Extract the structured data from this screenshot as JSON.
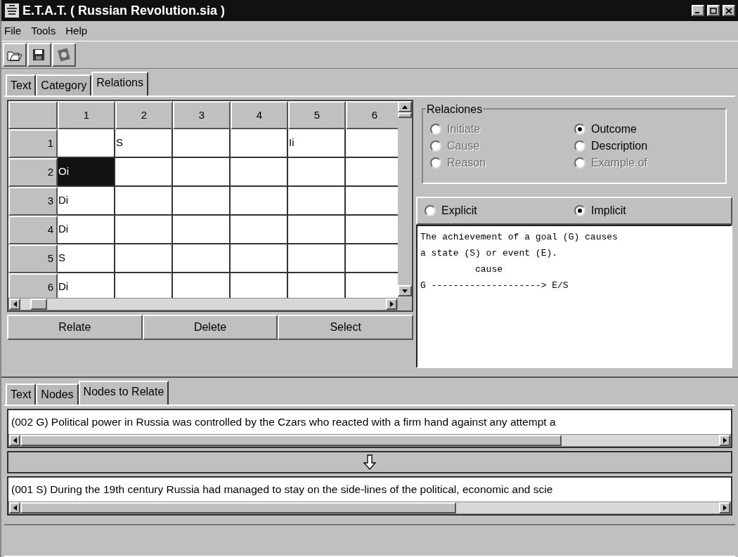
{
  "window": {
    "title": "E.T.A.T. ( Russian Revolution.sia )"
  },
  "menu": [
    "File",
    "Tools",
    "Help"
  ],
  "tabs": [
    {
      "label": "Text",
      "selected": false
    },
    {
      "label": "Category",
      "selected": false
    },
    {
      "label": "Relations",
      "selected": true
    }
  ],
  "grid": {
    "columns": [
      "1",
      "2",
      "3",
      "4",
      "5",
      "6"
    ],
    "rows": [
      {
        "label": "1",
        "cells": [
          {
            "selected": false
          },
          {
            "text": "S",
            "selected": false
          },
          {
            "selected": false
          },
          {
            "selected": false
          },
          {
            "text": "Ii",
            "selected": false
          },
          {
            "selected": false
          }
        ]
      },
      {
        "label": "2",
        "cells": [
          {
            "text": "Oi",
            "selected": true
          },
          {
            "selected": false
          },
          {
            "selected": false
          },
          {
            "selected": false
          },
          {
            "selected": false
          },
          {
            "selected": false
          }
        ]
      },
      {
        "label": "3",
        "cells": [
          {
            "text": "Di",
            "selected": false
          },
          {
            "selected": false
          },
          {
            "selected": false
          },
          {
            "selected": false
          },
          {
            "selected": false
          },
          {
            "selected": false
          }
        ]
      },
      {
        "label": "4",
        "cells": [
          {
            "text": "Di",
            "selected": false
          },
          {
            "selected": false
          },
          {
            "selected": false
          },
          {
            "selected": false
          },
          {
            "selected": false
          },
          {
            "selected": false
          }
        ]
      },
      {
        "label": "5",
        "cells": [
          {
            "text": "S",
            "selected": false
          },
          {
            "selected": false
          },
          {
            "selected": false
          },
          {
            "selected": false
          },
          {
            "selected": false
          },
          {
            "selected": false
          }
        ]
      },
      {
        "label": "6",
        "cells": [
          {
            "text": "Di",
            "selected": false
          },
          {
            "selected": false
          },
          {
            "selected": false
          },
          {
            "selected": false
          },
          {
            "selected": false
          },
          {
            "selected": false
          }
        ]
      }
    ]
  },
  "buttons": [
    "Relate",
    "Delete",
    "Select"
  ],
  "relaciones": {
    "title": "Relaciones",
    "options": [
      {
        "label": "Initiate",
        "selected": false,
        "disabled": true
      },
      {
        "label": "Outcome",
        "selected": true,
        "disabled": false
      },
      {
        "label": "Cause",
        "selected": false,
        "disabled": true
      },
      {
        "label": "Description",
        "selected": false,
        "disabled": false
      },
      {
        "label": "Reason",
        "selected": false,
        "disabled": true
      },
      {
        "label": "Example of",
        "selected": false,
        "disabled": true
      }
    ]
  },
  "mode": [
    {
      "label": "Explicit",
      "selected": false
    },
    {
      "label": "Implicit",
      "selected": true
    }
  ],
  "description": "The achievement of a goal (G) causes\na state (S) or event (E).\n          cause\nG --------------------> E/S",
  "bottom_tabs": [
    {
      "label": "Text",
      "selected": false
    },
    {
      "label": "Nodes",
      "selected": false
    },
    {
      "label": "Nodes to Relate",
      "selected": true
    }
  ],
  "node_from": "(002 G) Political power in Russia was controlled by the Czars who reacted with a firm hand against any attempt a",
  "node_to": "(001 S) During the 19th century Russia had managed to stay on the side-lines of the political, economic and scie"
}
